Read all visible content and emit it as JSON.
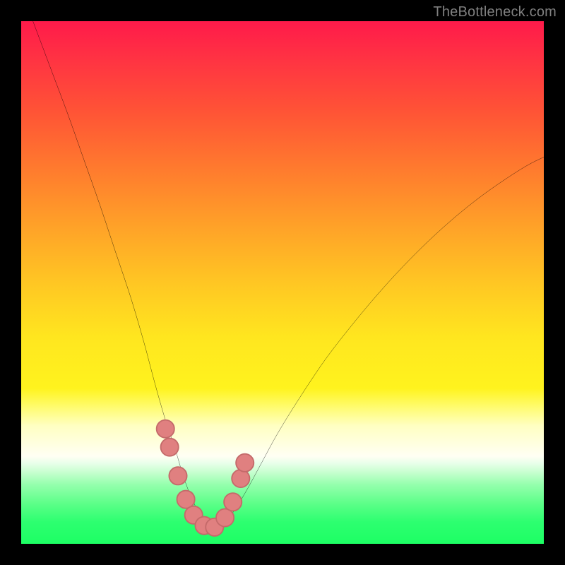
{
  "watermark": {
    "text": "TheBottleneck.com"
  },
  "colors": {
    "background": "#000000",
    "curve": "#000000",
    "marker_fill": "#e08080",
    "marker_stroke": "#c46a6a",
    "gradient_top": "#ff1a4a",
    "gradient_mid": "#fff31e",
    "gradient_bottom": "#1dff64"
  },
  "chart_data": {
    "type": "line",
    "title": "",
    "xlabel": "",
    "ylabel": "",
    "xlim": [
      0,
      100
    ],
    "ylim": [
      0,
      100
    ],
    "grid": false,
    "curve": {
      "name": "bottleneck-curve",
      "x": [
        0,
        3,
        6,
        9,
        12,
        15,
        18,
        21,
        23.5,
        25.5,
        27.5,
        29.5,
        31,
        32.5,
        34,
        35.5,
        37,
        38.5,
        40.5,
        43,
        46,
        49,
        53,
        58,
        63,
        68,
        73,
        78,
        83,
        88,
        93,
        97,
        100
      ],
      "y": [
        106,
        98,
        90,
        82,
        73.5,
        65,
        56,
        47,
        38.5,
        31,
        24,
        18,
        13,
        9,
        6,
        4,
        3,
        4,
        6,
        10,
        15.5,
        21,
        27.5,
        35,
        41.5,
        47.5,
        53,
        58,
        62.5,
        66.5,
        70,
        72.5,
        74
      ]
    },
    "markers": {
      "x": [
        27.6,
        28.4,
        30.0,
        31.5,
        33.0,
        35.0,
        37.0,
        39.0,
        40.5,
        42.0,
        42.8
      ],
      "y": [
        22.0,
        18.5,
        13.0,
        8.5,
        5.5,
        3.5,
        3.2,
        5.0,
        8.0,
        12.5,
        15.5
      ],
      "radius_pct": 1.7
    }
  }
}
